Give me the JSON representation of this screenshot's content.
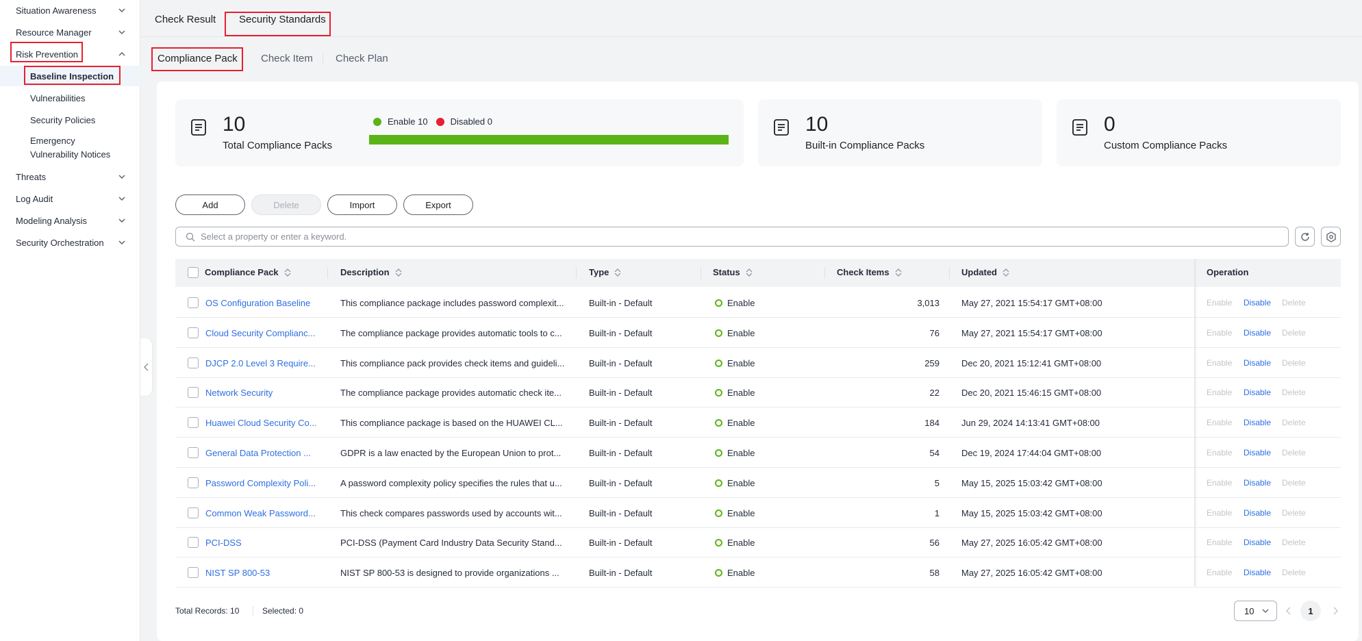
{
  "sidebar": {
    "items": [
      {
        "label": "Situation Awareness"
      },
      {
        "label": "Resource Manager"
      },
      {
        "label": "Risk Prevention"
      },
      {
        "label": "Threats"
      },
      {
        "label": "Log Audit"
      },
      {
        "label": "Modeling Analysis"
      },
      {
        "label": "Security Orchestration"
      }
    ],
    "sub_items": [
      {
        "label": "Baseline Inspection"
      },
      {
        "label": "Vulnerabilities"
      },
      {
        "label": "Security Policies"
      },
      {
        "label": "Emergency"
      },
      {
        "label": "Vulnerability Notices"
      }
    ]
  },
  "top_tabs": [
    "Check Result",
    "Security Standards"
  ],
  "sub_tabs": [
    "Compliance Pack",
    "Check Item",
    "Check Plan"
  ],
  "stats": {
    "total": {
      "value": "10",
      "label": "Total Compliance Packs"
    },
    "enable_label": "Enable 10",
    "disabled_label": "Disabled 0",
    "enabled_fraction": 1.0,
    "builtin": {
      "value": "10",
      "label": "Built-in Compliance Packs"
    },
    "custom": {
      "value": "0",
      "label": "Custom Compliance Packs"
    }
  },
  "buttons": {
    "add": "Add",
    "delete": "Delete",
    "import": "Import",
    "export": "Export"
  },
  "search": {
    "placeholder": "Select a property or enter a keyword."
  },
  "table": {
    "headers": [
      "Compliance Pack",
      "Description",
      "Type",
      "Status",
      "Check Items",
      "Updated",
      "Operation"
    ],
    "op_labels": {
      "enable": "Enable",
      "disable": "Disable",
      "delete": "Delete"
    },
    "rows": [
      {
        "name": "OS Configuration Baseline",
        "desc": "This compliance package includes password complexit...",
        "type": "Built-in - Default",
        "status": "Enable",
        "items": "3,013",
        "updated": "May 27, 2021 15:54:17 GMT+08:00"
      },
      {
        "name": "Cloud Security Complianc...",
        "desc": "The compliance package provides automatic tools to c...",
        "type": "Built-in - Default",
        "status": "Enable",
        "items": "76",
        "updated": "May 27, 2021 15:54:17 GMT+08:00"
      },
      {
        "name": "DJCP 2.0 Level 3 Require...",
        "desc": "This compliance pack provides check items and guideli...",
        "type": "Built-in - Default",
        "status": "Enable",
        "items": "259",
        "updated": "Dec 20, 2021 15:12:41 GMT+08:00"
      },
      {
        "name": "Network Security",
        "desc": "The compliance package provides automatic check ite...",
        "type": "Built-in - Default",
        "status": "Enable",
        "items": "22",
        "updated": "Dec 20, 2021 15:46:15 GMT+08:00"
      },
      {
        "name": "Huawei Cloud Security Co...",
        "desc": "This compliance package is based on the HUAWEI CL...",
        "type": "Built-in - Default",
        "status": "Enable",
        "items": "184",
        "updated": "Jun 29, 2024 14:13:41 GMT+08:00"
      },
      {
        "name": "General Data Protection ...",
        "desc": "GDPR is a law enacted by the European Union to prot...",
        "type": "Built-in - Default",
        "status": "Enable",
        "items": "54",
        "updated": "Dec 19, 2024 17:44:04 GMT+08:00"
      },
      {
        "name": "Password Complexity Poli...",
        "desc": "A password complexity policy specifies the rules that u...",
        "type": "Built-in - Default",
        "status": "Enable",
        "items": "5",
        "updated": "May 15, 2025 15:03:42 GMT+08:00"
      },
      {
        "name": "Common Weak Password...",
        "desc": "This check compares passwords used by accounts wit...",
        "type": "Built-in - Default",
        "status": "Enable",
        "items": "1",
        "updated": "May 15, 2025 15:03:42 GMT+08:00"
      },
      {
        "name": "PCI-DSS",
        "desc": "PCI-DSS (Payment Card Industry Data Security Stand...",
        "type": "Built-in - Default",
        "status": "Enable",
        "items": "56",
        "updated": "May 27, 2025 16:05:42 GMT+08:00"
      },
      {
        "name": "NIST SP 800-53",
        "desc": "NIST SP 800-53 is designed to provide organizations ...",
        "type": "Built-in - Default",
        "status": "Enable",
        "items": "58",
        "updated": "May 27, 2025 16:05:42 GMT+08:00"
      }
    ]
  },
  "footer": {
    "total": "Total Records: 10",
    "selected": "Selected: 0",
    "page_size": "10",
    "page": "1"
  },
  "colors": {
    "accent": "#2e6fe1",
    "enable": "#5bb417",
    "disabled": "#e5212e",
    "highlight": "#e5212e"
  }
}
